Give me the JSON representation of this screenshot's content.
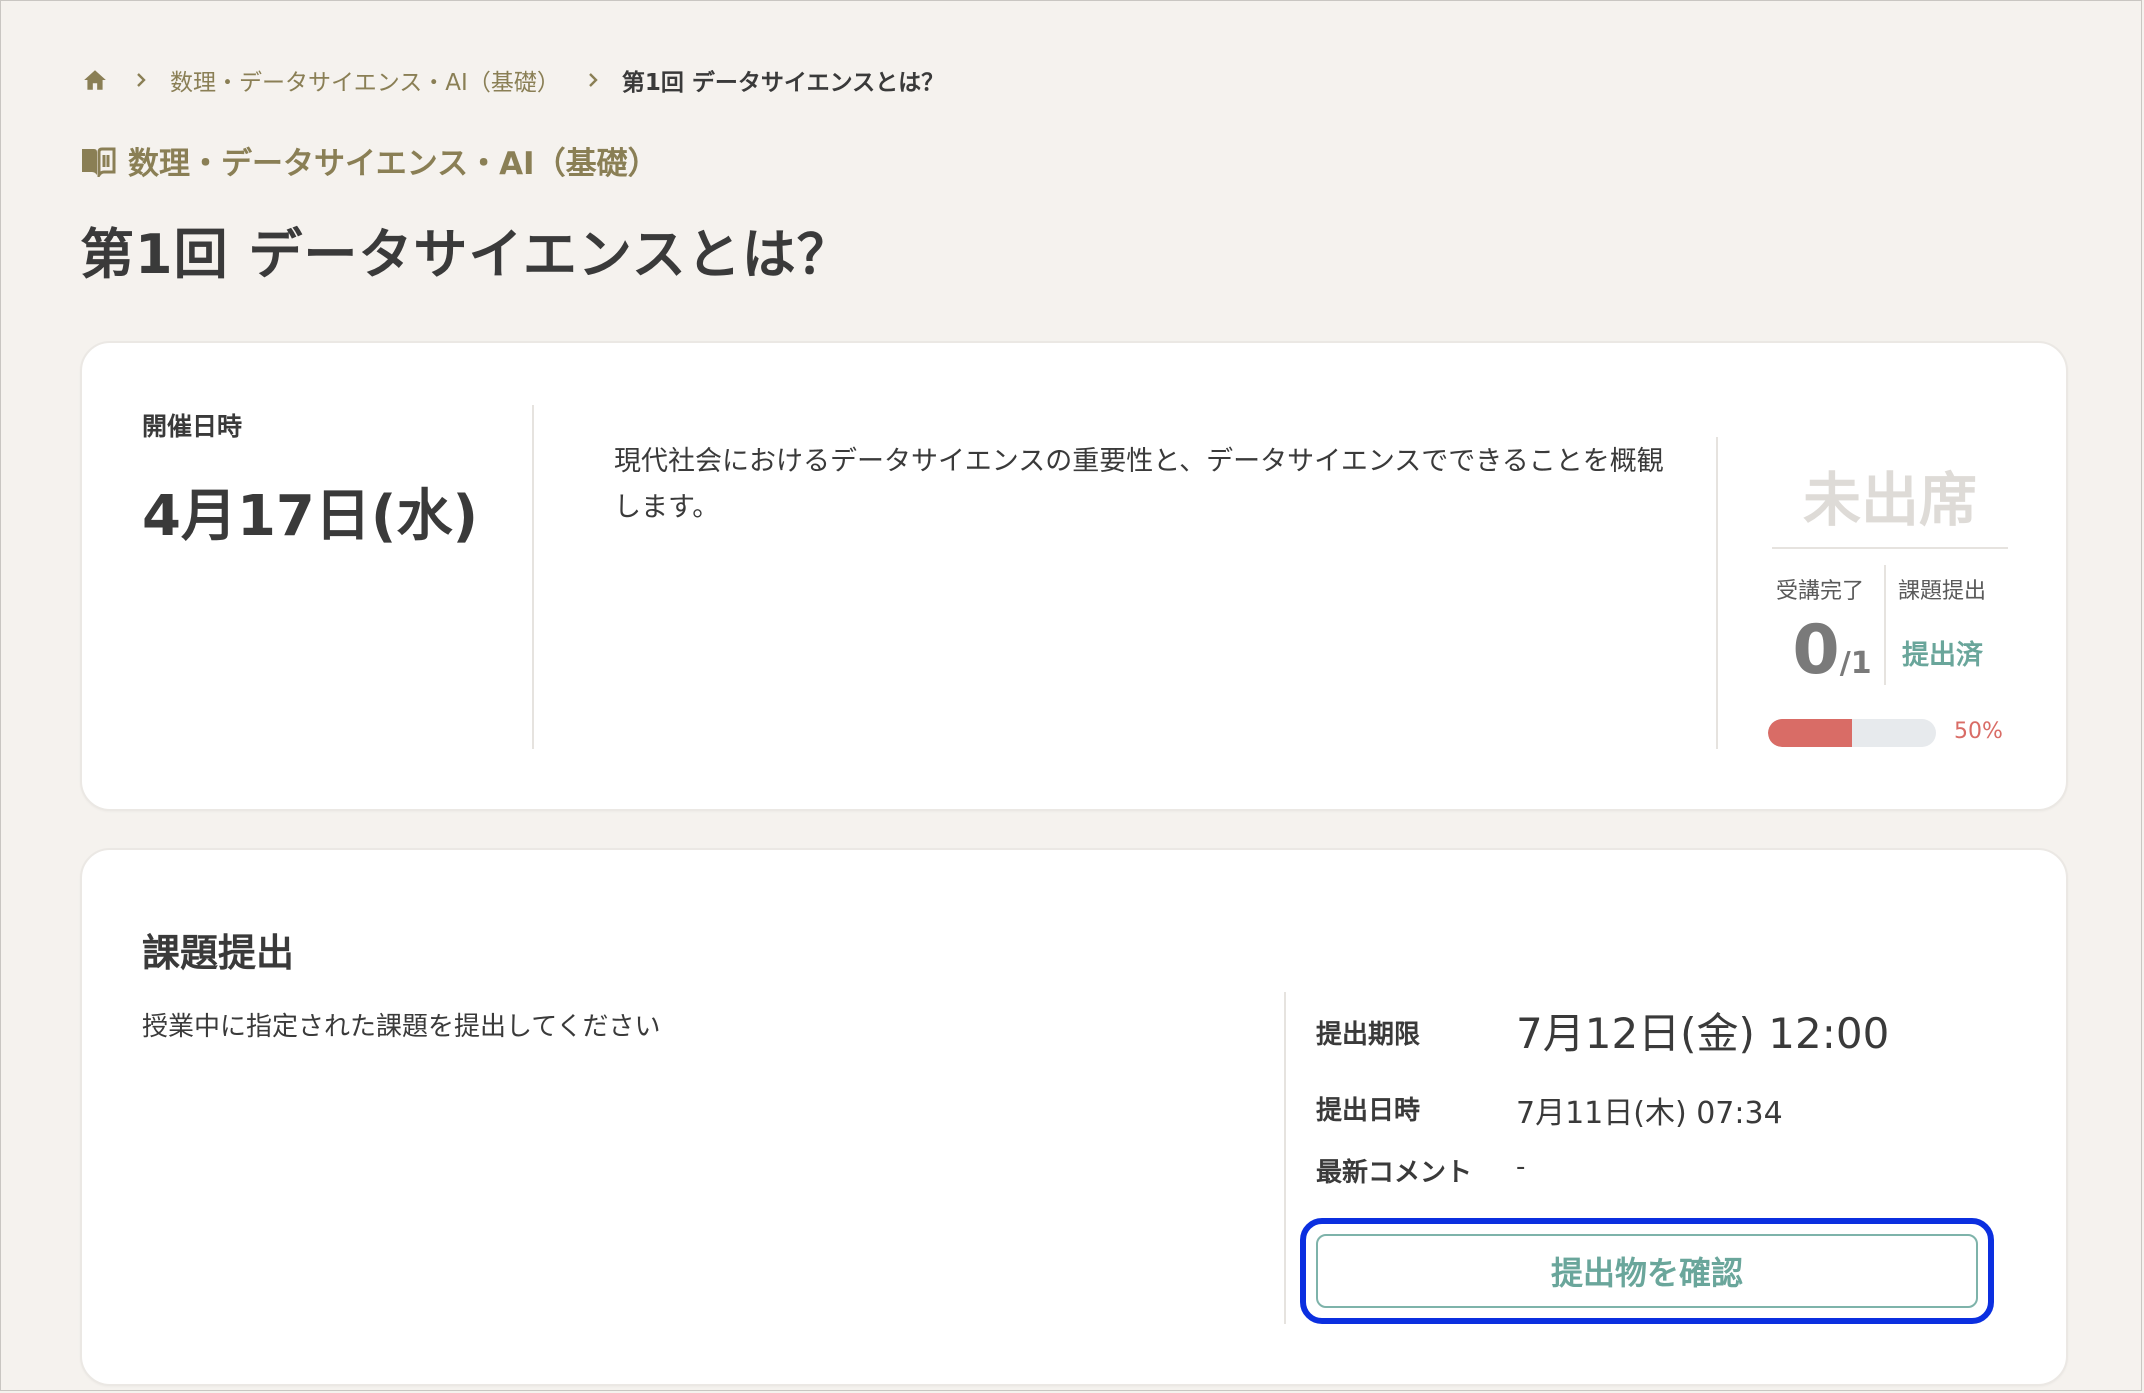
{
  "breadcrumb": {
    "home_icon": "home-icon",
    "separator_icon": "chevron-right-icon",
    "course": "数理・データサイエンス・AI（基礎）",
    "current": "第1回 データサイエンスとは？"
  },
  "course": {
    "icon": "book-icon",
    "name": "数理・データサイエンス・AI（基礎）"
  },
  "page_title": "第1回 データサイエンスとは？",
  "session": {
    "date_label": "開催日時",
    "date_value": "4月17日(水)",
    "description": "現代社会におけるデータサイエンスの重要性と、データサイエンスでできることを概観します。",
    "status": "未出席",
    "attend_label": "受講完了",
    "attend_done": "0",
    "attend_total": "/1",
    "submit_label": "課題提出",
    "submit_status": "提出済",
    "progress_percent": 50,
    "progress_text": "50%",
    "colors": {
      "progress": "#d96c66",
      "accent": "#6aa69b",
      "brand": "#8a7f55"
    }
  },
  "assignment": {
    "title": "課題提出",
    "description": "授業中に指定された課題を提出してください",
    "deadline_label": "提出期限",
    "deadline_value": "7月12日(金) 12:00",
    "submitted_label": "提出日時",
    "submitted_value": "7月11日(木) 07:34",
    "comment_label": "最新コメント",
    "comment_value": "-",
    "check_button": "提出物を確認"
  }
}
